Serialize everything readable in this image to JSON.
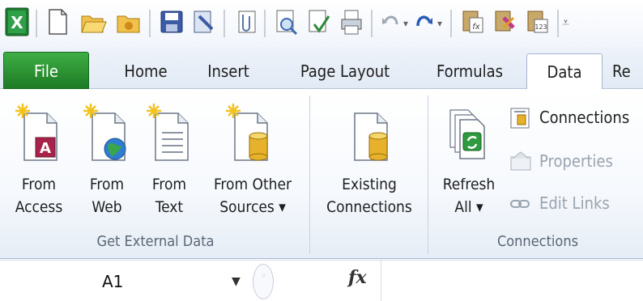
{
  "tabs": [
    {
      "label": "File"
    },
    {
      "label": "Home"
    },
    {
      "label": "Insert"
    },
    {
      "label": "Page Layout"
    },
    {
      "label": "Formulas"
    },
    {
      "label": "Data"
    },
    {
      "label": "Re"
    }
  ],
  "ribbon": {
    "get_external_data": {
      "group_label": "Get External Data",
      "buttons": [
        {
          "line1": "From",
          "line2": "Access",
          "icon": "access-icon"
        },
        {
          "line1": "From",
          "line2": "Web",
          "icon": "web-icon"
        },
        {
          "line1": "From",
          "line2": "Text",
          "icon": "text-file-icon"
        },
        {
          "line1": "From Other",
          "line2": "Sources ▾",
          "icon": "database-icon"
        }
      ]
    },
    "existing": {
      "line1": "Existing",
      "line2": "Connections",
      "icon": "existing-connections-icon"
    },
    "connections": {
      "group_label": "Connections",
      "refresh": {
        "line1": "Refresh",
        "line2": "All ▾",
        "icon": "refresh-icon"
      },
      "connections_label": "Connections",
      "properties_label": "Properties",
      "edit_links_label": "Edit Links"
    }
  },
  "formula_bar": {
    "name_box": "A1",
    "fx": "fx"
  },
  "colors": {
    "file_tab": "#2a8c30",
    "ribbon_bg": "#f6f9fd",
    "tab_row_bg": "#e7eef7"
  }
}
